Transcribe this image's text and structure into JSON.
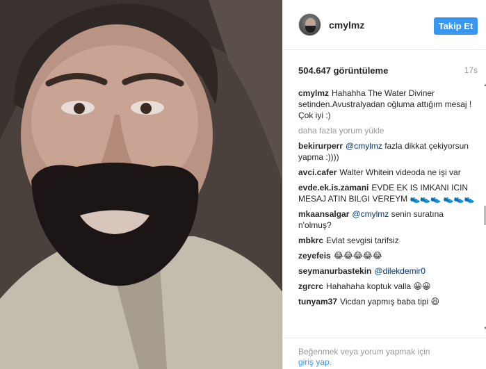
{
  "post": {
    "username": "cmylmz",
    "follow_label": "Takip Et",
    "views": "504.647 görüntüleme",
    "time_ago": "17s"
  },
  "caption": {
    "user": "cmylmz",
    "text": "Hahahha The Water Diviner setinden.Avustralyadan oğluma attığım mesaj ! Çok iyi :)"
  },
  "load_more_label": "daha fazla yorum yükle",
  "comments": [
    {
      "user": "bekirurperr",
      "mention": "@cmylmz",
      "text": "fazla dikkat çekiyorsun yapma :))))"
    },
    {
      "user": "avci.cafer",
      "mention": "",
      "text": "Walter Whitein videoda ne işi var"
    },
    {
      "user": "evde.ek.is.zamani",
      "mention": "",
      "text": "EVDE EK IS IMKANI ICIN MESAJ ATIN BILGI VEREYM 👟👟👟 👟👟👟"
    },
    {
      "user": "mkaansalgar",
      "mention": "@cmylmz",
      "text": "senin suratına n'olmuş?"
    },
    {
      "user": "mbkrc",
      "mention": "",
      "text": "Evlat sevgisi tarifsiz"
    },
    {
      "user": "zeyefeis",
      "mention": "",
      "text": "😂😂😂😂😂"
    },
    {
      "user": "seymanurbastekin",
      "mention": "@dilekdemir0",
      "text": ""
    },
    {
      "user": "zgrcrc",
      "mention": "",
      "text": "Hahahaha koptuk valla 😀😀"
    },
    {
      "user": "tunyam37",
      "mention": "",
      "text": "Vicdan yapmış baba tipi 😆"
    }
  ],
  "footer": {
    "prefix": "Beğenmek veya yorum yapmak için",
    "link": "giriş yap",
    "suffix": "."
  },
  "colors": {
    "follow_button": "#3897f0",
    "mention": "#003569",
    "muted": "#999999"
  }
}
